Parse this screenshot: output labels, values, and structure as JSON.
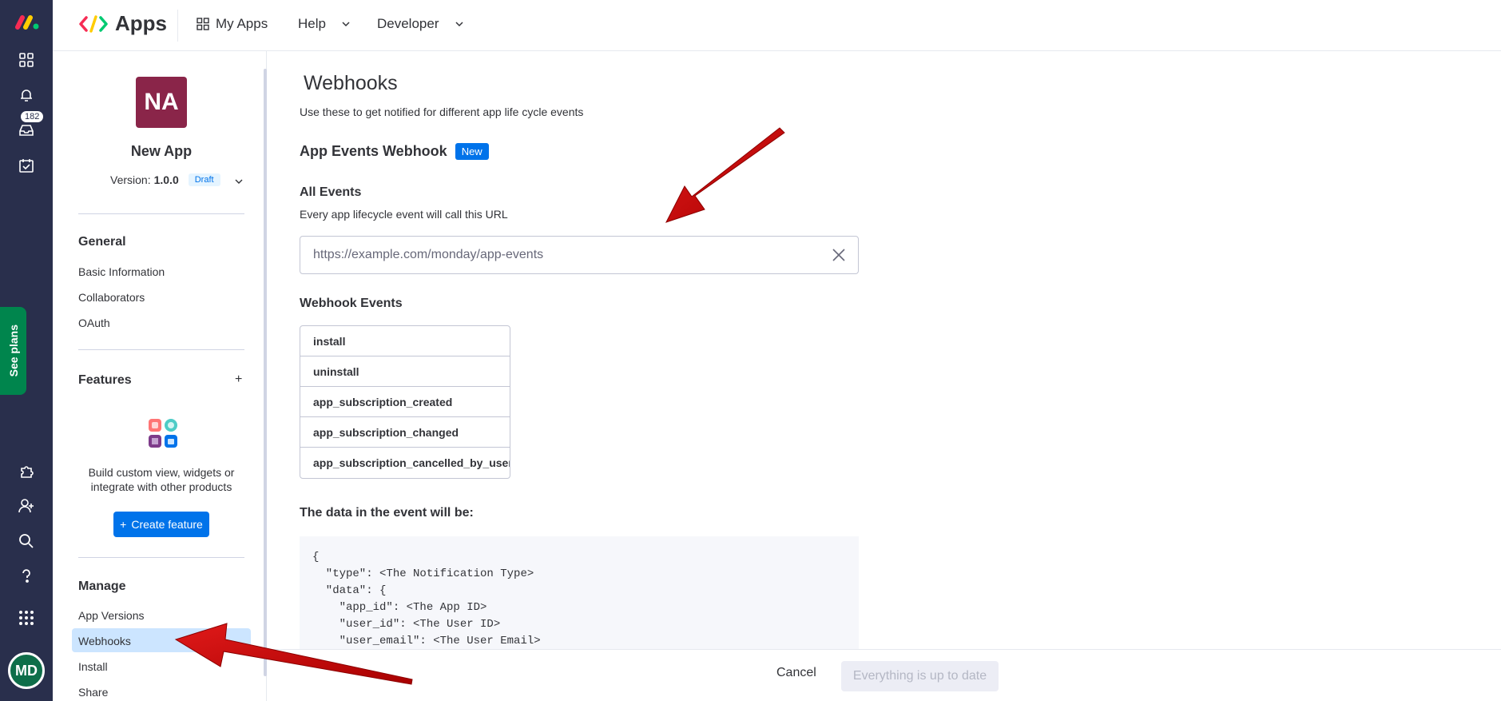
{
  "rail": {
    "notifications_count": "182",
    "see_plans": "See plans",
    "user_initials": "MD"
  },
  "topbar": {
    "title": "Apps",
    "nav": [
      {
        "label": "My Apps"
      },
      {
        "label": "Help"
      },
      {
        "label": "Developer"
      }
    ]
  },
  "sidebar": {
    "app_initials": "NA",
    "app_name": "New App",
    "version_prefix": "Version:",
    "version": "1.0.0",
    "status": "Draft",
    "general": {
      "title": "General",
      "items": [
        "Basic Information",
        "Collaborators",
        "OAuth"
      ]
    },
    "features": {
      "title": "Features",
      "add": "+",
      "description": "Build custom view, widgets or integrate with other products",
      "create_label": "Create feature"
    },
    "manage": {
      "title": "Manage",
      "items": [
        "App Versions",
        "Webhooks",
        "Install",
        "Share"
      ],
      "active": "Webhooks"
    }
  },
  "main": {
    "title": "Webhooks",
    "subtitle": "Use these to get notified for different app life cycle events",
    "section_title": "App Events Webhook",
    "section_badge": "New",
    "all_events_title": "All Events",
    "all_events_hint": "Every app lifecycle event will call this URL",
    "url_placeholder": "https://example.com/monday/app-events",
    "webhook_events_title": "Webhook Events",
    "events": [
      "install",
      "uninstall",
      "app_subscription_created",
      "app_subscription_changed",
      "app_subscription_cancelled_by_user"
    ],
    "data_title": "The data in the event will be:",
    "code": "{\n  \"type\": <The Notification Type>\n  \"data\": {\n    \"app_id\": <The App ID>\n    \"user_id\": <The User ID>\n    \"user_email\": <The User Email>"
  },
  "footer": {
    "cancel_label": "Cancel",
    "save_label": "Everything is up to date"
  },
  "colors": {
    "rail": "#292f4c",
    "primary": "#0073ea",
    "active_item": "#cce5ff",
    "app_avatar": "#8a2549",
    "see_plans": "#00854d",
    "annotation_arrow": "#cc0000"
  }
}
